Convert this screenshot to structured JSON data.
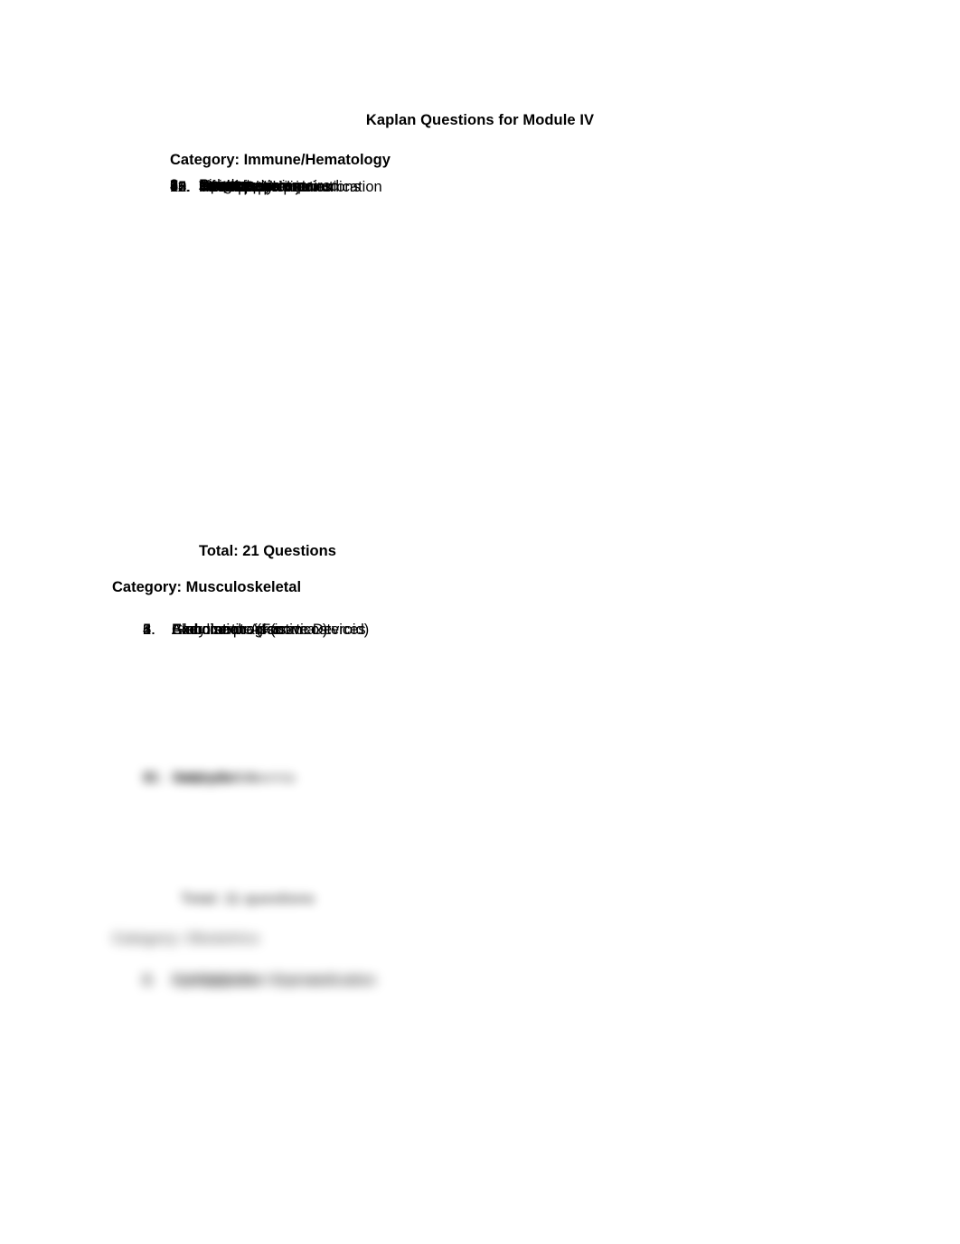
{
  "document": {
    "title": "Kaplan Questions for Module IV",
    "background_color": "#ffffff",
    "text_color": "#000000"
  },
  "sections": [
    {
      "heading": "Category: Immune/Hematology",
      "visible": true,
      "items": [
        "Airborne",
        "Contact",
        "Droplet",
        "Immune system",
        "Immunization",
        "Infection",
        "Integument: impaired",
        "Iron supplement",
        "Lipids",
        "Needle stick injuries",
        "Neutropenic precautions",
        "NSAIDS",
        "Phenazopyridine",
        "Standard precaution",
        "Therapeutic communication"
      ],
      "total": "Total: 21 Questions"
    },
    {
      "heading": "Category: Musculoskeletal",
      "visible": true,
      "items": [
        "Alendronate (Fosamax)",
        "Ambulation",
        "Ambulation Assistive Devices",
        "Body mechanics",
        "Exercise program",
        "Glucocorticoid (corticosteroid)"
      ],
      "obscured_items": [
        "Ice pack",
        "Osteoporosis",
        "Pain",
        "Paralysis",
        "Sickle Cell Anemia"
      ],
      "obscured_total": "Total: 11 questions"
    },
    {
      "heading": "Category: Obstetrics",
      "visible": false,
      "obscured_items": [
        "Administration: Eye medication",
        "Administration: Ear medication",
        "Antibiotics",
        "Caring for the Newborn",
        "Eye Irrigation",
        "Eye Scabies"
      ]
    }
  ],
  "labels": {
    "immuno_heading": "Category: Immune/Hematology",
    "immuno_total": "Total: 21 Questions",
    "msk_heading": "Category: Musculoskeletal"
  }
}
